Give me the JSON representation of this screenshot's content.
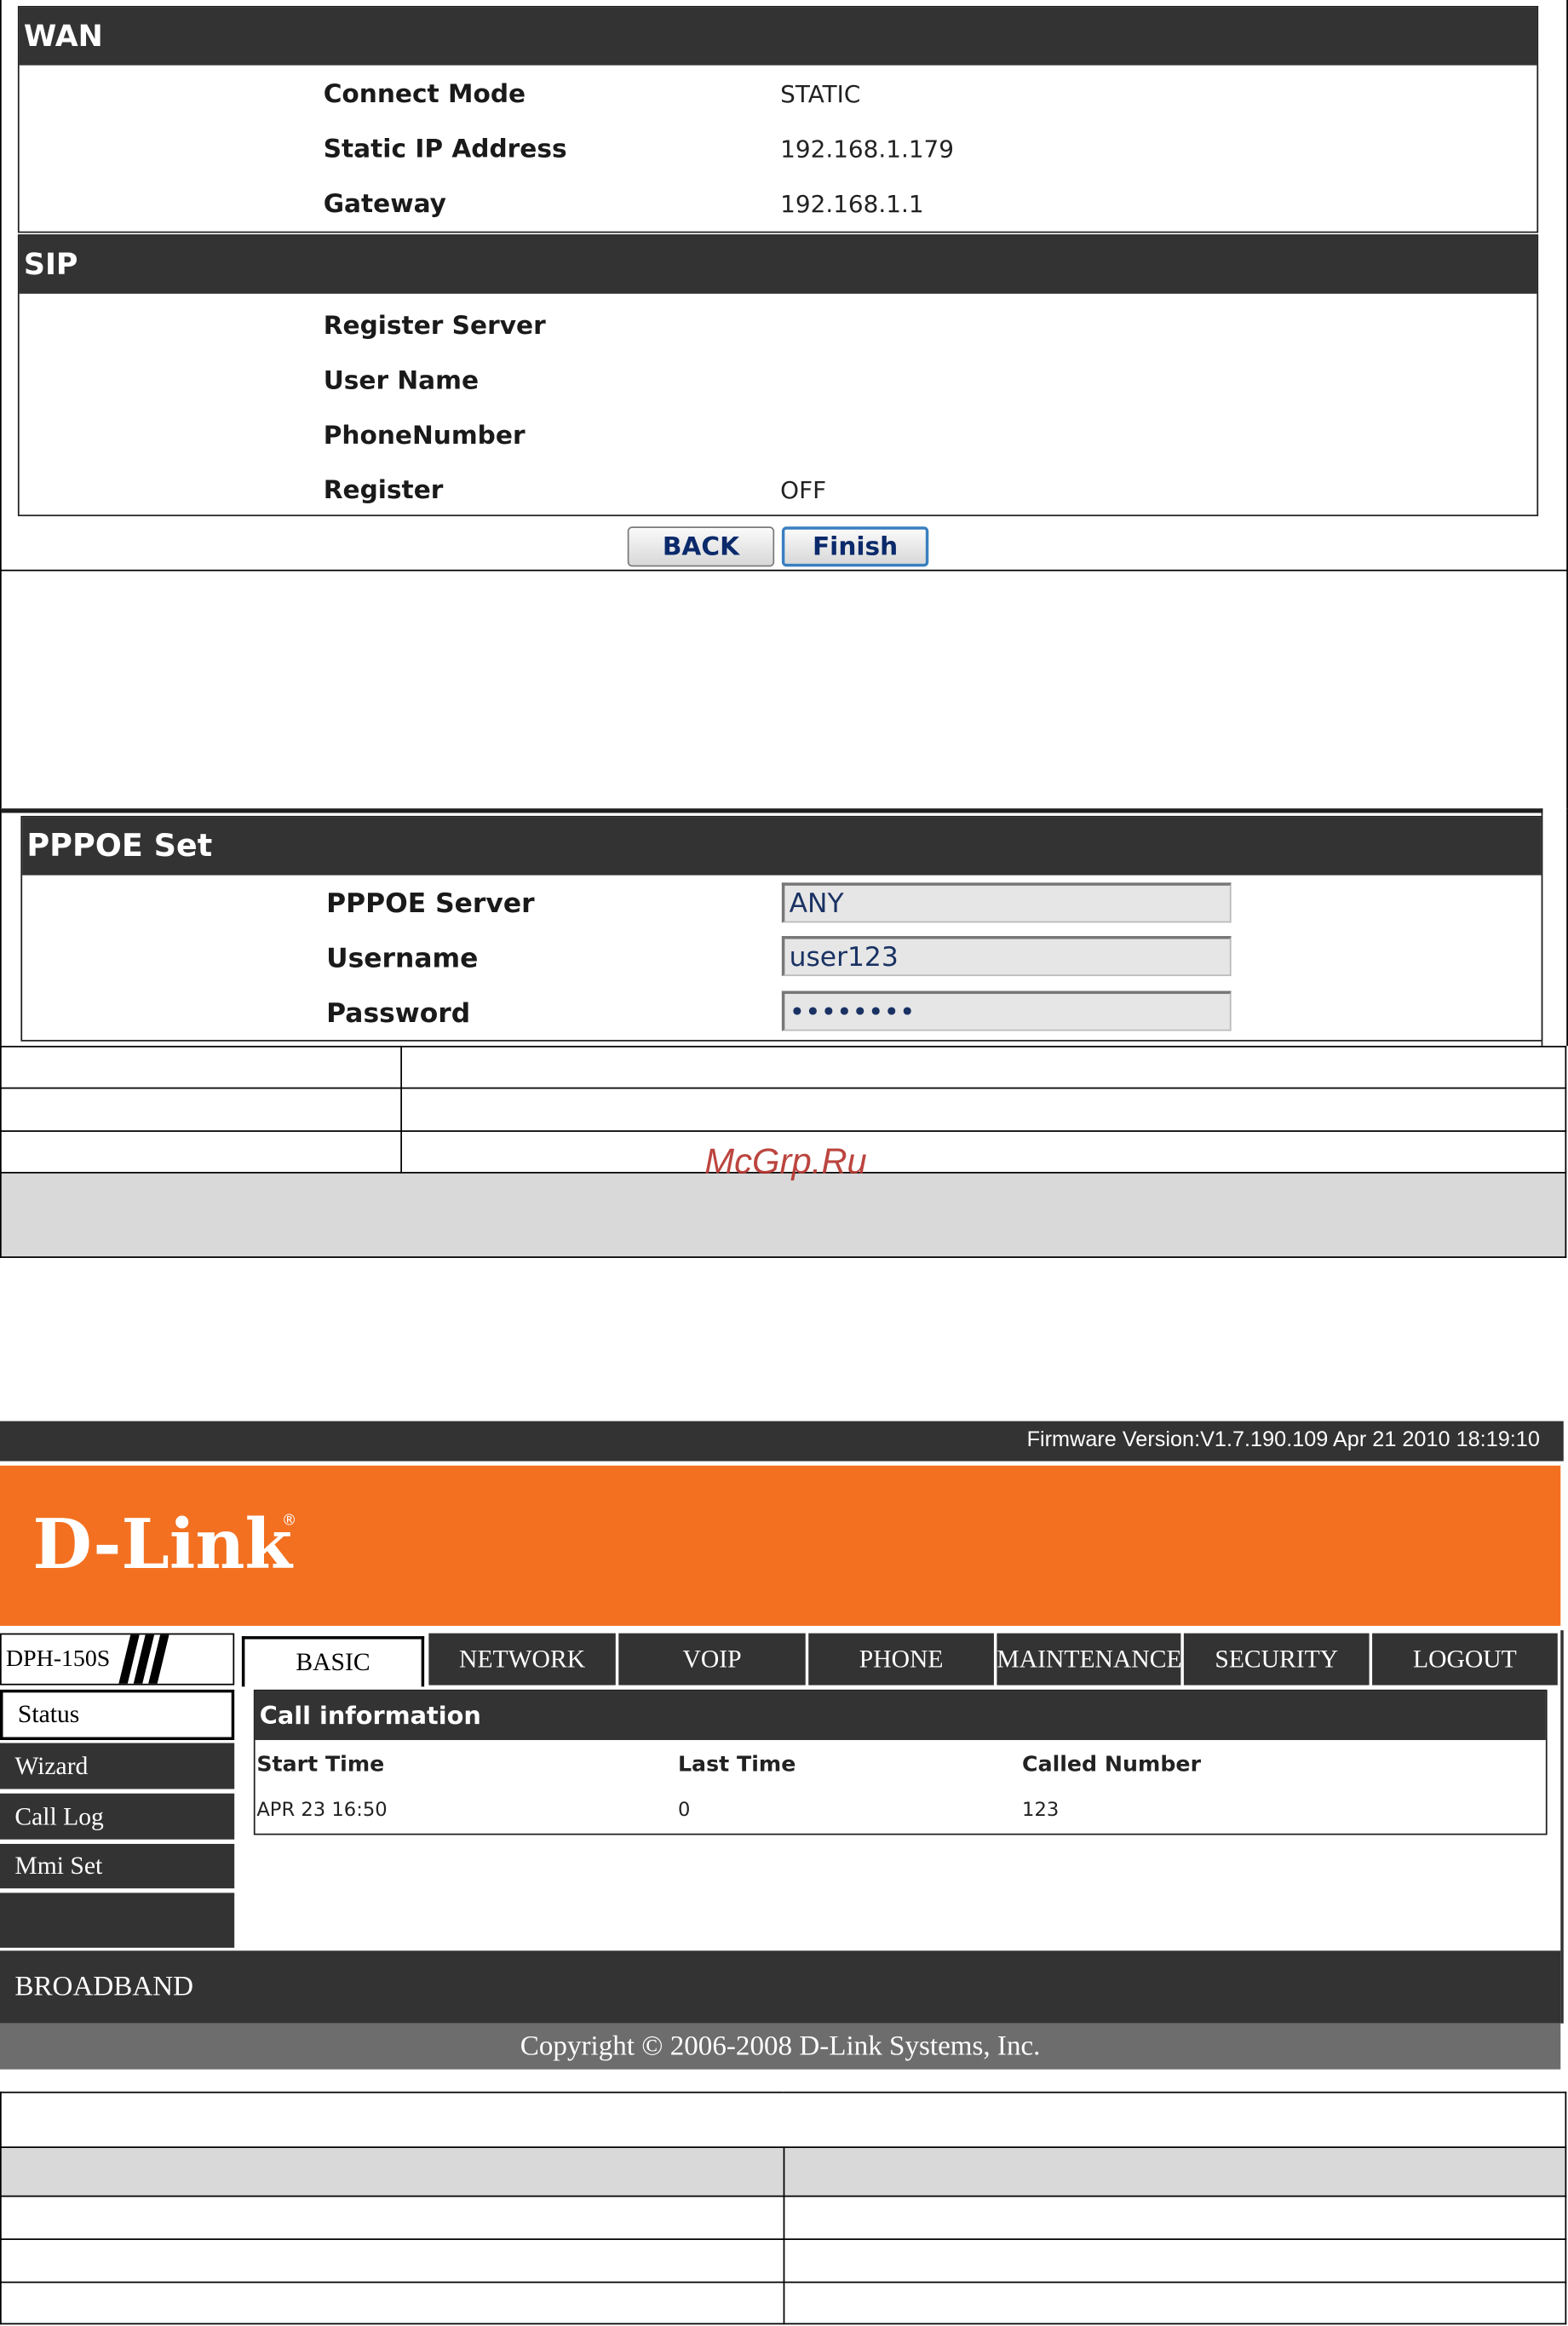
{
  "wizard": {
    "wan": {
      "title": "WAN",
      "rows": [
        {
          "label": "Connect Mode",
          "value": "STATIC"
        },
        {
          "label": "Static IP Address",
          "value": "192.168.1.179"
        },
        {
          "label": "Gateway",
          "value": "192.168.1.1"
        }
      ]
    },
    "sip": {
      "title": "SIP",
      "rows": [
        {
          "label": "Register Server"
        },
        {
          "label": "User Name"
        },
        {
          "label": "PhoneNumber"
        },
        {
          "label": "Register",
          "value": "OFF"
        }
      ]
    },
    "buttons": {
      "back": "BACK",
      "finish": "Finish"
    }
  },
  "pppoe": {
    "title": "PPPOE Set",
    "fields": [
      {
        "label": "PPPOE Server",
        "value": "ANY"
      },
      {
        "label": "Username",
        "value": "user123"
      },
      {
        "label": "Password",
        "value": "••••••••"
      }
    ]
  },
  "watermark": "McGrp.Ru",
  "dlink": {
    "firmware": "Firmware Version:V1.7.190.109 Apr 21 2010 18:19:10",
    "logo": {
      "text": "D-Link",
      "mark": "®"
    },
    "model": "DPH-150S",
    "tabs": [
      {
        "label": "BASIC",
        "active": true
      },
      {
        "label": "NETWORK"
      },
      {
        "label": "VOIP"
      },
      {
        "label": "PHONE"
      },
      {
        "label": "MAINTENANCE"
      },
      {
        "label": "SECURITY"
      },
      {
        "label": "LOGOUT"
      }
    ],
    "sidebar": [
      {
        "label": "Status",
        "active": true
      },
      {
        "label": "Wizard"
      },
      {
        "label": "Call Log"
      },
      {
        "label": "Mmi Set"
      }
    ],
    "call_information": {
      "title": "Call information",
      "columns": [
        "Start Time",
        "Last Time",
        "Called Number"
      ],
      "rows": [
        [
          "APR 23 16:50",
          "0",
          "123"
        ]
      ]
    },
    "footer_section": "BROADBAND",
    "copyright": "Copyright © 2006-2008 D-Link Systems, Inc."
  },
  "colors": {
    "dark_bar": "#333333",
    "brand_orange": "#f37021",
    "copyright_bar": "#6d6d6d",
    "table_shade": "#d9d9d9",
    "button_text": "#0b2a6b",
    "input_text": "#1a3263",
    "input_background": "#e6e6e6",
    "watermark": "#b5312b",
    "focus_border": "#3a7fc1"
  }
}
